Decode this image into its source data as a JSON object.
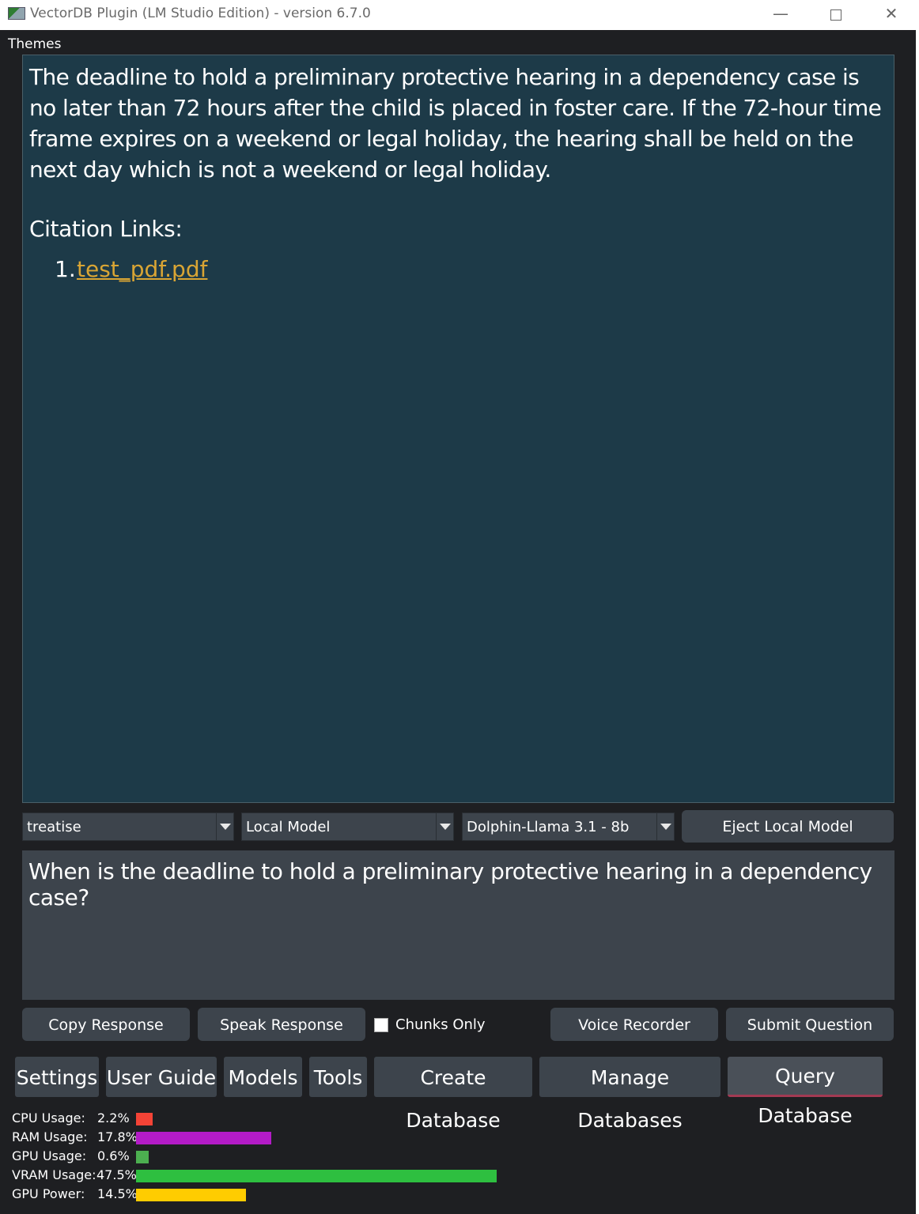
{
  "window": {
    "title": "VectorDB Plugin (LM Studio Edition) - version 6.7.0",
    "minimize_glyph": "—",
    "close_glyph": "✕"
  },
  "menu": {
    "themes": "Themes"
  },
  "response": {
    "text": "The deadline to hold a preliminary protective hearing in a dependency case is no later than 72 hours after the child is placed in foster care. If the 72-hour time frame expires on a weekend or legal holiday, the hearing shall be held on the next day which is not a weekend or legal holiday.",
    "citation_heading": "Citation Links:",
    "citations": [
      {
        "number": "1.",
        "label": "test_pdf.pdf"
      }
    ],
    "link_color": "#d9a534"
  },
  "controls": {
    "database_select": "treatise",
    "model_source_select": "Local Model",
    "model_select": "Dolphin-Llama 3.1 - 8b",
    "eject_button": "Eject Local Model"
  },
  "question": {
    "value": "When is the deadline to hold a preliminary protective hearing in a dependency case?"
  },
  "actions": {
    "copy": "Copy Response",
    "speak": "Speak Response",
    "chunks_only_label": "Chunks Only",
    "chunks_only_checked": false,
    "voice": "Voice Recorder",
    "submit": "Submit Question"
  },
  "tabs": [
    {
      "label": "Settings"
    },
    {
      "label": "User Guide"
    },
    {
      "label": "Models"
    },
    {
      "label": "Tools"
    },
    {
      "label": "Create Database"
    },
    {
      "label": "Manage Databases"
    },
    {
      "label": "Query Database",
      "active": true
    }
  ],
  "stats": [
    {
      "label": "CPU Usage:",
      "value": "2.2%",
      "percent": 2.2,
      "color": "#f44336"
    },
    {
      "label": "RAM Usage:",
      "value": "17.8%",
      "percent": 17.8,
      "color": "#b31bc7"
    },
    {
      "label": "GPU Usage:",
      "value": "0.6%",
      "percent": 0.6,
      "color": "#4caf50"
    },
    {
      "label": "VRAM Usage:",
      "value": "47.5%",
      "percent": 47.5,
      "color": "#2ebf40"
    },
    {
      "label": "GPU Power:",
      "value": "14.5%",
      "percent": 14.5,
      "color": "#ffcc00"
    }
  ]
}
